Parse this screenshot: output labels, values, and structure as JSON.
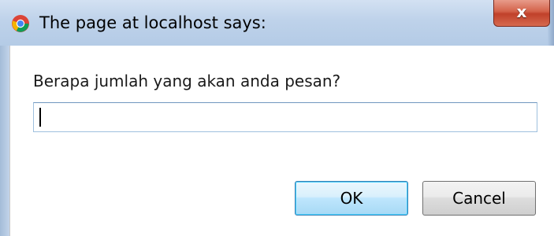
{
  "window": {
    "title": "The page at localhost says:",
    "app_icon": "chrome-icon",
    "close_glyph": "x"
  },
  "dialog": {
    "prompt": "Berapa jumlah yang akan anda pesan?",
    "input_value": "",
    "ok_label": "OK",
    "cancel_label": "Cancel"
  }
}
